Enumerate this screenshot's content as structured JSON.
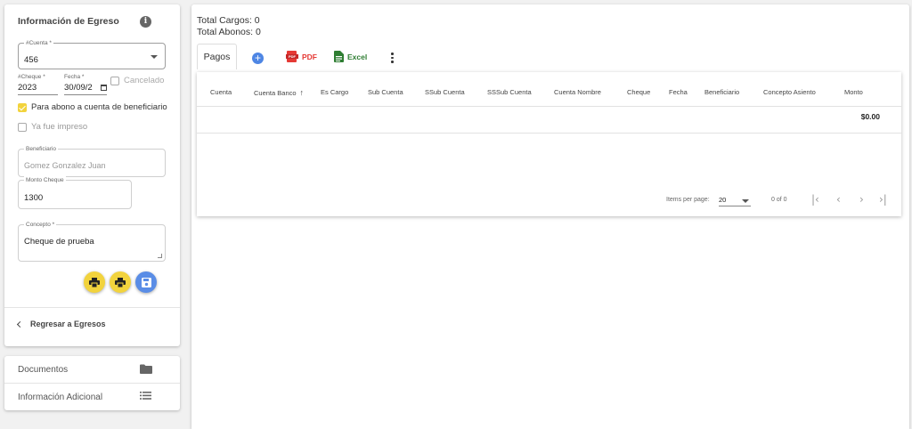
{
  "sidebar": {
    "title": "Información de Egreso",
    "info_icon": "info-icon",
    "cuenta": {
      "label": "#Cuenta *",
      "value": "456"
    },
    "cheque": {
      "label": "#Cheque *",
      "value": "2023"
    },
    "fecha": {
      "label": "Fecha *",
      "value": "30/09/2"
    },
    "cancelado": {
      "label": "Cancelado",
      "checked": false
    },
    "abono": {
      "label": "Para abono a cuenta de beneficiario",
      "checked": true
    },
    "impreso": {
      "label": "Ya fue impreso",
      "checked": false
    },
    "beneficiario": {
      "label": "Beneficiario",
      "value": "Gomez Gonzalez Juan"
    },
    "monto": {
      "label": "Monto Cheque",
      "value": "1300"
    },
    "concepto": {
      "label": "Concepto *",
      "value": "Cheque de prueba"
    },
    "actions": [
      "print-icon",
      "print-icon",
      "save-icon"
    ],
    "back_label": "Regresar a Egresos",
    "accordion": [
      {
        "label": "Documentos",
        "icon": "folder-icon"
      },
      {
        "label": "Información Adicional",
        "icon": "list-icon"
      }
    ]
  },
  "main": {
    "total_cargos": "Total Cargos: 0",
    "total_abonos": "Total Abonos: 0",
    "tab_label": "Pagos",
    "toolbar": {
      "pdf_label": "PDF",
      "excel_label": "Excel"
    },
    "columns": [
      "Cuenta",
      "Cuenta Banco",
      "Es Cargo",
      "Sub Cuenta",
      "SSub Cuenta",
      "SSSub Cuenta",
      "Cuenta Nombre",
      "Cheque",
      "Fecha",
      "Beneficiario",
      "Concepto Asiento",
      "Monto"
    ],
    "total_monto": "$0.00",
    "paginator": {
      "items_per_page_label": "Items per page:",
      "page_size": "20",
      "range": "0 of 0"
    }
  },
  "colors": {
    "accent_yellow": "#f2d33d",
    "accent_blue": "#5a8de6",
    "pdf_red": "#e53935",
    "excel_green": "#2e7d32"
  }
}
